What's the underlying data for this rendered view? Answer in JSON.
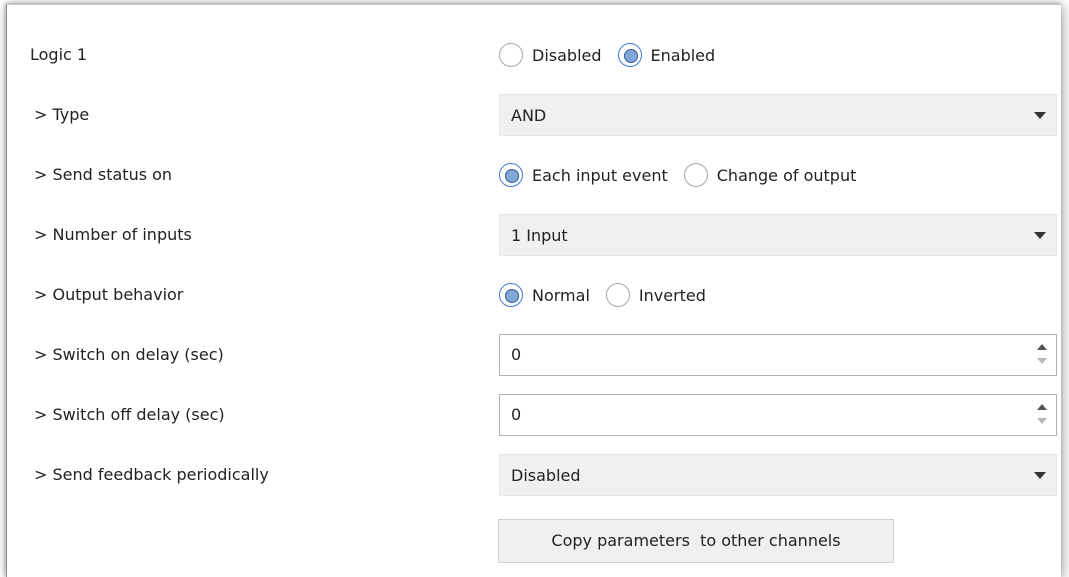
{
  "rows": {
    "logic": {
      "label": "Logic 1",
      "options": [
        "Disabled",
        "Enabled"
      ],
      "selected": "Enabled"
    },
    "type": {
      "label": "> Type",
      "value": "AND"
    },
    "send_status": {
      "label": "> Send status on",
      "options": [
        "Each input event",
        "Change of output"
      ],
      "selected": "Each input event"
    },
    "number_of_inputs": {
      "label": "> Number of inputs",
      "value": "1 Input"
    },
    "output_behavior": {
      "label": "> Output behavior",
      "options": [
        "Normal",
        "Inverted"
      ],
      "selected": "Normal"
    },
    "switch_on_delay": {
      "label": "> Switch on delay (sec)",
      "value": "0"
    },
    "switch_off_delay": {
      "label": "> Switch off delay (sec)",
      "value": "0"
    },
    "send_feedback": {
      "label": "> Send feedback periodically",
      "value": "Disabled"
    }
  },
  "copy_button_label": "Copy parameters  to other channels",
  "colors": {
    "radio_checked_border": "#3a7bd5",
    "radio_checked_dot": "#7fa8d8",
    "dropdown_bg": "#f0f0f0"
  },
  "icons": {
    "dropdown": "chevron-down-icon",
    "spin_up": "arrow-up-icon",
    "spin_down": "arrow-down-icon"
  }
}
